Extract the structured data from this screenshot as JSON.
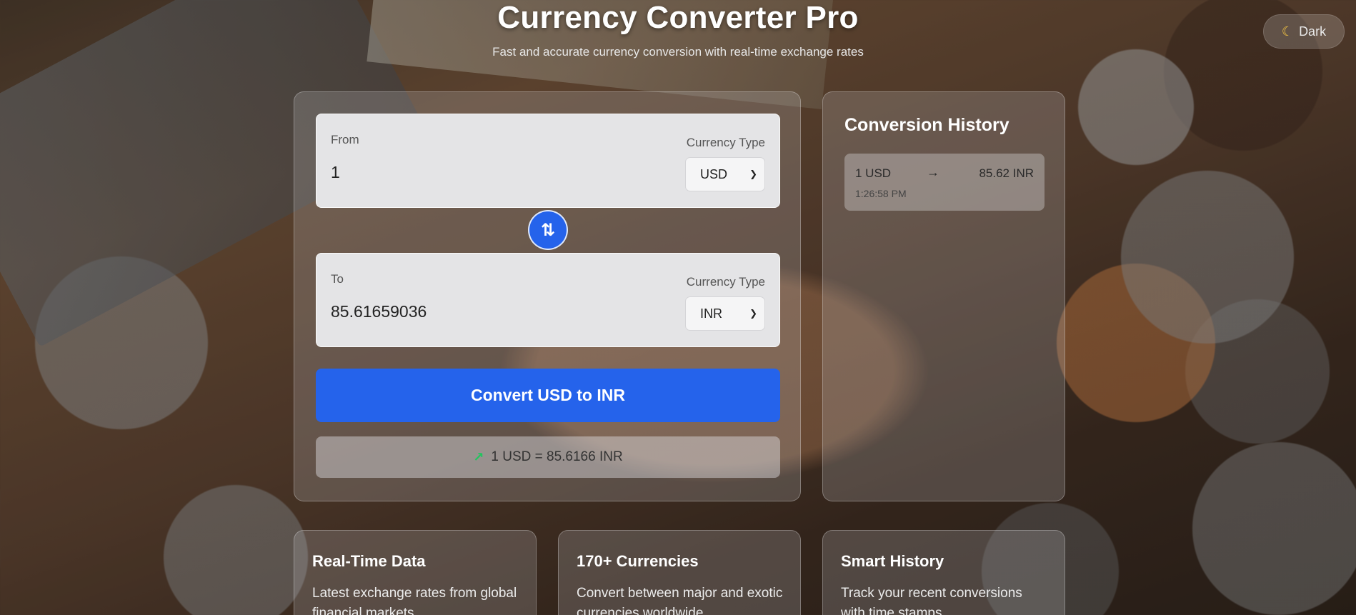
{
  "header": {
    "title": "Currency Converter Pro",
    "subtitle": "Fast and accurate currency conversion with real-time exchange rates"
  },
  "theme_toggle": {
    "icon": "moon-icon",
    "label": "Dark"
  },
  "converter": {
    "from": {
      "label": "From",
      "value": "1",
      "currency_type_label": "Currency Type",
      "currency": "USD"
    },
    "to": {
      "label": "To",
      "value": "85.61659036",
      "currency_type_label": "Currency Type",
      "currency": "INR"
    },
    "swap_icon": "swap-arrows-icon",
    "convert_label": "Convert USD to INR",
    "rate_text": "1 USD = 85.6166 INR",
    "rate_icon": "trending-up-icon"
  },
  "history": {
    "title": "Conversion History",
    "items": [
      {
        "from": "1 USD",
        "arrow": "→",
        "to": "85.62 INR",
        "time": "1:26:58 PM"
      }
    ]
  },
  "features": [
    {
      "title": "Real-Time Data",
      "text": "Latest exchange rates from global financial markets"
    },
    {
      "title": "170+ Currencies",
      "text": "Convert between major and exotic currencies worldwide"
    },
    {
      "title": "Smart History",
      "text": "Track your recent conversions with time stamps"
    }
  ],
  "colors": {
    "accent": "#2563eb",
    "trend": "#22c55e",
    "moon": "#f5c542"
  }
}
